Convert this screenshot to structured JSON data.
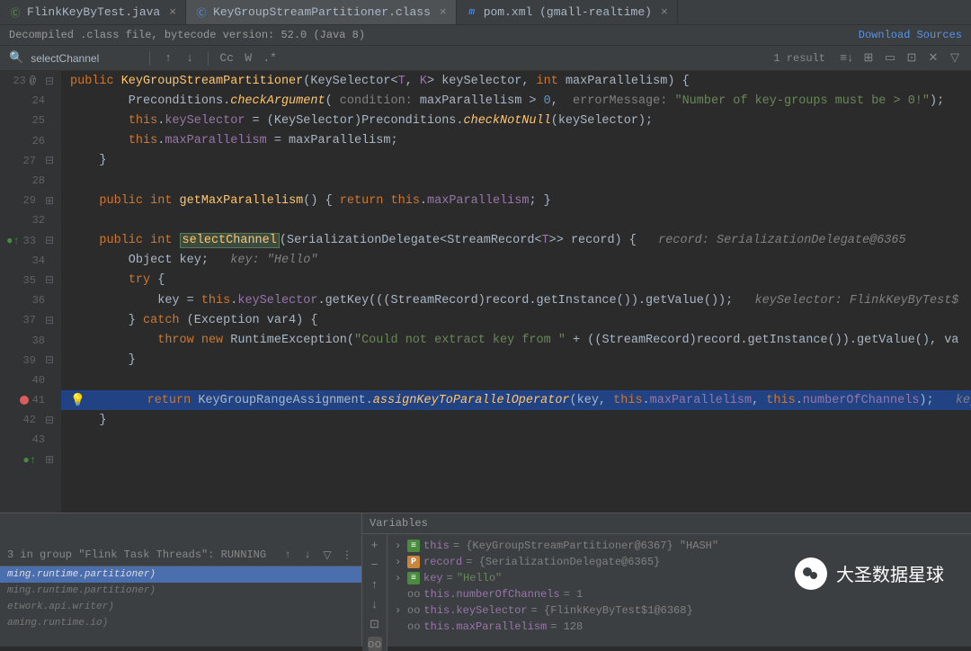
{
  "tabs": [
    {
      "label": "FlinkKeyByTest.java",
      "icon": "C",
      "iconColor": "#5b9e4d"
    },
    {
      "label": "KeyGroupStreamPartitioner.class",
      "icon": "C",
      "iconColor": "#5394ec",
      "active": true
    },
    {
      "label": "pom.xml (gmall-realtime)",
      "icon": "m",
      "iconColor": "#5394ec"
    }
  ],
  "info": {
    "text": "Decompiled .class file, bytecode version: 52.0 (Java 8)",
    "download": "Download Sources"
  },
  "search": {
    "value": "selectChannel",
    "cc": "Cc",
    "w": "W",
    "regex": ".*",
    "result": "1 result"
  },
  "lines": {
    "l23": "23",
    "l24": "24",
    "l25": "25",
    "l26": "26",
    "l27": "27",
    "l28": "28",
    "l29": "29",
    "l32": "32",
    "l33": "33",
    "l34": "34",
    "l35": "35",
    "l36": "36",
    "l37": "37",
    "l38": "38",
    "l39": "39",
    "l40": "40",
    "l41": "41",
    "l42": "42",
    "l43": "43"
  },
  "code": {
    "l23_1": "public",
    "l23_2": " KeyGroupStreamPartitioner",
    "l23_3": "(KeySelector<",
    "l23_4": "T",
    "l23_5": ", ",
    "l23_6": "K",
    "l23_7": "> keySelector, ",
    "l23_8": "int",
    "l23_9": " maxParallelism) {",
    "l24_1": "        Preconditions.",
    "l24_2": "checkArgument",
    "l24_3": "(",
    "l24_p1": " condition: ",
    "l24_4": "maxParallelism > ",
    "l24_5": "0",
    "l24_6": ",",
    "l24_p2": "  errorMessage: ",
    "l24_7": "\"Number of key-groups must be > 0!\"",
    "l24_8": ");",
    "l25_1": "        ",
    "l25_2": "this",
    "l25_3": ".",
    "l25_4": "keySelector",
    "l25_5": " = (KeySelector)Preconditions.",
    "l25_6": "checkNotNull",
    "l25_7": "(keySelector);",
    "l26_1": "        ",
    "l26_2": "this",
    "l26_3": ".",
    "l26_4": "maxParallelism",
    "l26_5": " = maxParallelism;",
    "l27": "    }",
    "l29_1": "    ",
    "l29_2": "public",
    "l29_3": " ",
    "l29_4": "int",
    "l29_5": " ",
    "l29_6": "getMaxParallelism",
    "l29_7": "() { ",
    "l29_8": "return",
    "l29_9": " ",
    "l29_10": "this",
    "l29_11": ".",
    "l29_12": "maxParallelism",
    "l29_13": "; }",
    "l33_1": "    ",
    "l33_2": "public",
    "l33_3": " ",
    "l33_4": "int",
    "l33_5": " ",
    "l33_6": "selectChannel",
    "l33_7": "(SerializationDelegate<StreamRecord<",
    "l33_8": "T",
    "l33_9": ">> record) {",
    "l33_c": "   record: SerializationDelegate@6365",
    "l34_1": "        Object key;",
    "l34_c": "   key: \"Hello\"",
    "l35_1": "        ",
    "l35_2": "try",
    "l35_3": " {",
    "l36_1": "            key = ",
    "l36_2": "this",
    "l36_3": ".",
    "l36_4": "keySelector",
    "l36_5": ".getKey(((StreamRecord)record.getInstance()).getValue());",
    "l36_c": "   keySelector: FlinkKeyByTest$",
    "l37_1": "        } ",
    "l37_2": "catch",
    "l37_3": " (Exception var4) {",
    "l38_1": "            ",
    "l38_2": "throw",
    "l38_3": " ",
    "l38_4": "new",
    "l38_5": " RuntimeException(",
    "l38_6": "\"Could not extract key from \"",
    "l38_7": " + ((StreamRecord)record.getInstance()).getValue(), va",
    "l39": "        }",
    "l41_1": "        ",
    "l41_2": "return",
    "l41_3": " KeyGroupRangeAssignment.",
    "l41_4": "assignKeyToParallelOperator",
    "l41_5": "(key, ",
    "l41_6": "this",
    "l41_7": ".",
    "l41_8": "maxParallelism",
    "l41_9": ", ",
    "l41_10": "this",
    "l41_11": ".",
    "l41_12": "numberOfChannels",
    "l41_13": ");",
    "l41_c": "   key",
    "l42": "    }"
  },
  "threads": {
    "header": "3 in group \"Flink Task Threads\": RUNNING",
    "t1": "ming.runtime.partitioner)",
    "t2": "ming.runtime.partitioner)",
    "t3": "etwork.api.writer)",
    "t4": "aming.runtime.io)"
  },
  "vars": {
    "header": "Variables",
    "v1_name": "this",
    "v1_val": " = {KeyGroupStreamPartitioner@6367} \"HASH\"",
    "v2_name": "record",
    "v2_val": " = {SerializationDelegate@6365}",
    "v3_name": "key",
    "v3_val": " = ",
    "v3_str": "\"Hello\"",
    "v4_pre": "oo ",
    "v4_name": "this.numberOfChannels",
    "v4_val": " = 1",
    "v5_pre": "oo ",
    "v5_name": "this.keySelector",
    "v5_val": " = {FlinkKeyByTest$1@6368}",
    "v6_pre": "oo ",
    "v6_name": "this.maxParallelism",
    "v6_val": " = 128"
  },
  "watermark": "大圣数据星球"
}
